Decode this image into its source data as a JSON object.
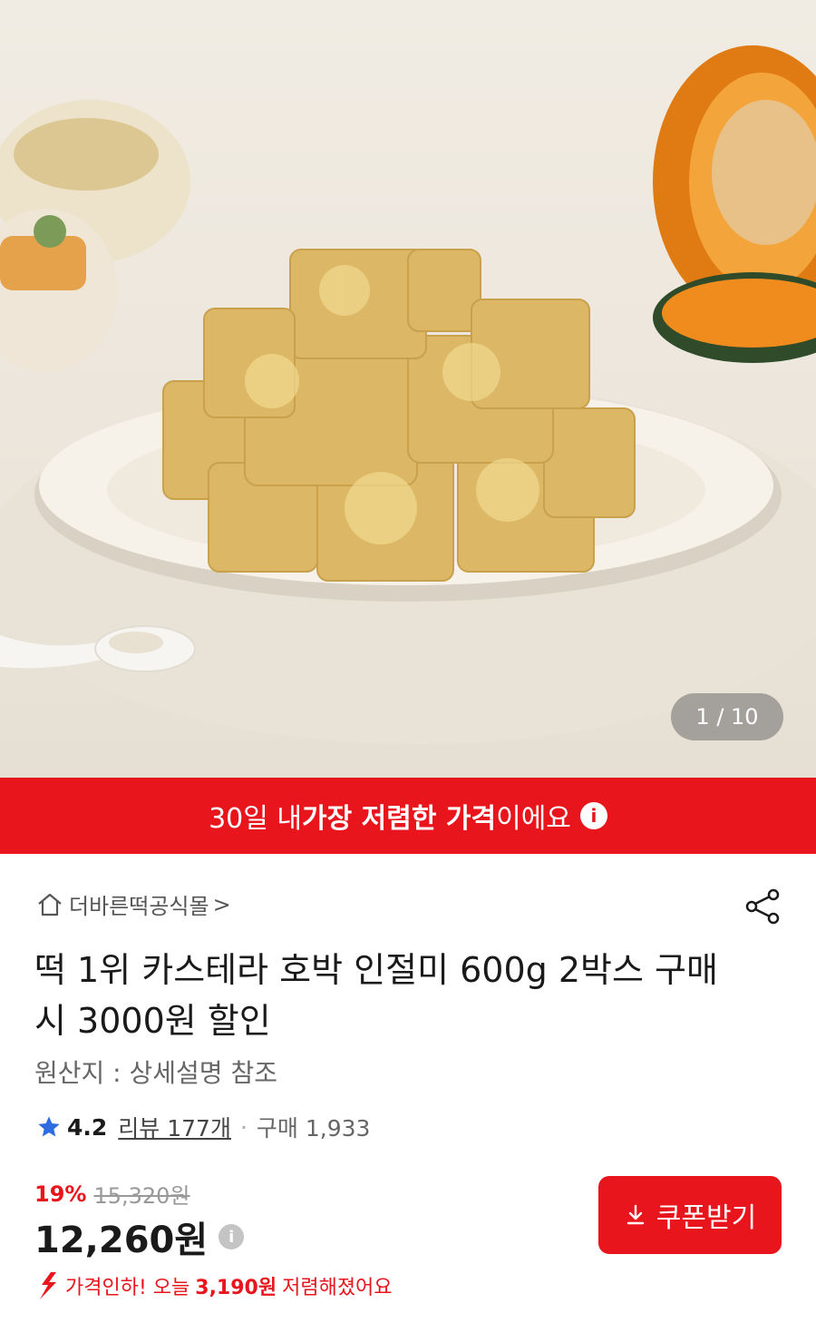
{
  "gallery": {
    "counter": "1 / 10"
  },
  "banner": {
    "prefix": "30일 내 ",
    "highlight": "가장 저렴한 가격",
    "suffix": "이에요"
  },
  "store": {
    "name": "더바른떡공식몰",
    "arrow": ">"
  },
  "product": {
    "title": "떡 1위 카스테라 호박 인절미 600g 2박스 구매시 3000원 할인",
    "origin": "원산지 : 상세설명 참조"
  },
  "rating": {
    "score": "4.2",
    "review": "리뷰 177개",
    "separator": "·",
    "purchases": "구매 1,933"
  },
  "pricing": {
    "discount": "19%",
    "original": "15,320원",
    "price": "12,260원",
    "drop_prefix": "가격인하! 오늘",
    "drop_amount": "3,190원",
    "drop_suffix": "저렴해졌어요"
  },
  "coupon": {
    "label": "쿠폰받기"
  },
  "colors": {
    "accent": "#e8161c"
  }
}
